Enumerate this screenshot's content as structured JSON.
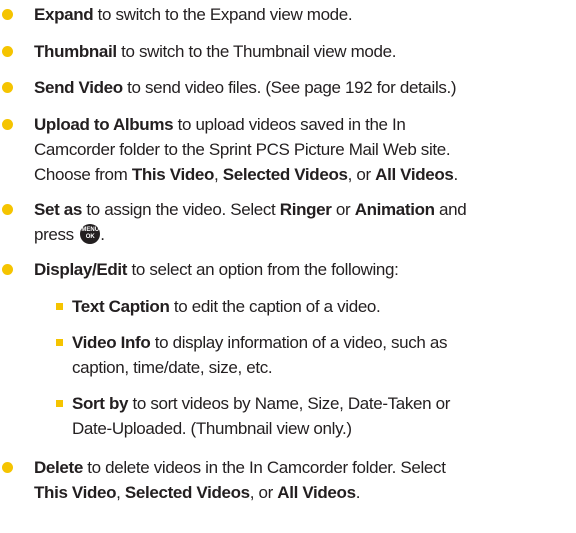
{
  "items": [
    {
      "bold": "Expand",
      "text": " to switch to the Expand view mode."
    },
    {
      "bold": "Thumbnail",
      "text": " to switch to the Thumbnail view mode."
    },
    {
      "bold": "Send Video",
      "text": " to send video files. (See page 192 for details.)"
    },
    {
      "bold": "Upload to Albums",
      "text": " to upload videos saved in the In",
      "line2": "Camcorder folder to the Sprint PCS Picture Mail Web site.",
      "line3_pre": "Choose from ",
      "opt1": "This Video",
      "sep1": ", ",
      "opt2": "Selected Videos",
      "sep2": ", or ",
      "opt3": "All Videos",
      "end": "."
    },
    {
      "bold": "Set as",
      "text": " to assign the video. Select ",
      "opt1": "Ringer",
      "mid": " or ",
      "opt2": "Animation",
      "tail": " and",
      "line2": "press",
      "key_top": "MENU",
      "key_bottom": "OK",
      "end": "."
    },
    {
      "bold": "Display/Edit",
      "text": " to select an option from the following:"
    },
    {
      "bold": "Delete",
      "text": " to delete videos in the In Camcorder folder. Select",
      "opt1": "This Video",
      "sep1": ", ",
      "opt2": "Selected Videos",
      "sep2": ", or ",
      "opt3": "All Videos",
      "end": "."
    }
  ],
  "subitems": [
    {
      "bold": "Text Caption",
      "text": " to edit the caption of a video."
    },
    {
      "bold": "Video Info",
      "text": " to display information of a video, such as",
      "line2": "caption, time/date, size, etc."
    },
    {
      "bold": "Sort by",
      "text": " to sort videos by Name, Size, Date-Taken or",
      "line2": "Date-Uploaded. (Thumbnail view only.)"
    }
  ],
  "colors": {
    "bullet": "#f5c400",
    "text": "#231f20"
  }
}
